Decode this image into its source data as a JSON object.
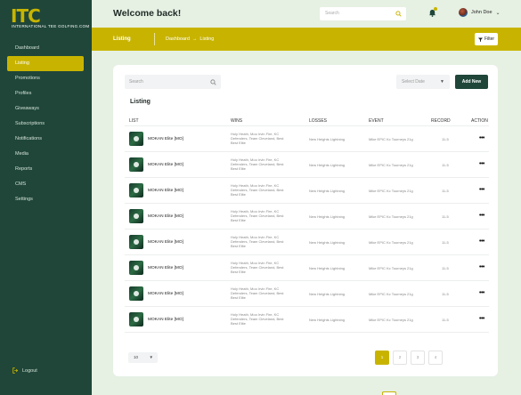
{
  "brand": {
    "logo_text": "ITC",
    "logo_subtext": "INTERNATIONAL TEE GOLFING.COM"
  },
  "sidebar": {
    "items": [
      {
        "label": "Dashboard",
        "active": false
      },
      {
        "label": "Listing",
        "active": true
      },
      {
        "label": "Promotions",
        "active": false
      },
      {
        "label": "Profiles",
        "active": false
      },
      {
        "label": "Giveaways",
        "active": false
      },
      {
        "label": "Subscriptions",
        "active": false
      },
      {
        "label": "Notifications",
        "active": false
      },
      {
        "label": "Media",
        "active": false
      },
      {
        "label": "Reports",
        "active": false
      },
      {
        "label": "CMS",
        "active": false
      },
      {
        "label": "Settings",
        "active": false
      }
    ],
    "logout_label": "Logout"
  },
  "header": {
    "welcome": "Welcome back!",
    "search_placeholder": "Search",
    "user_name": "John Doe"
  },
  "subheader": {
    "title": "Listing",
    "breadcrumb": [
      "Dashboard",
      "→",
      "Listing"
    ],
    "filter_label": "Filter"
  },
  "listing": {
    "search_placeholder": "Search",
    "date_select": "Select Date",
    "add_button": "Add New",
    "title": "Listing",
    "columns": [
      "LIST",
      "WINS",
      "LOSSES",
      "EVENT",
      "RECORD",
      "ACTION"
    ],
    "rows": [
      {
        "list": "MOKAN Elite [MO]",
        "wins": "Holy Heath, Moo Irvin Fire, KC Defenders, Team Cleveland, Best Best Elite",
        "losses": "New Heights Lightning",
        "event": "Mike EPIC Kc Tourneys 21g",
        "record": "11-5"
      },
      {
        "list": "MOKAN Elite [MO]",
        "wins": "Holy Heath, Moo Irvin Fire, KC Defenders, Team Cleveland, Best Best Elite",
        "losses": "New Heights Lightning",
        "event": "Mike EPIC Kc Tourneys 21g",
        "record": "11-5"
      },
      {
        "list": "MOKAN Elite [MO]",
        "wins": "Holy Heath, Moo Irvin Fire, KC Defenders, Team Cleveland, Best Best Elite",
        "losses": "New Heights Lightning",
        "event": "Mike EPIC Kc Tourneys 21g",
        "record": "11-5"
      },
      {
        "list": "MOKAN Elite [MO]",
        "wins": "Holy Heath, Moo Irvin Fire, KC Defenders, Team Cleveland, Best Best Elite",
        "losses": "New Heights Lightning",
        "event": "Mike EPIC Kc Tourneys 21g",
        "record": "11-5"
      },
      {
        "list": "MOKAN Elite [MO]",
        "wins": "Holy Heath, Moo Irvin Fire, KC Defenders, Team Cleveland, Best Best Elite",
        "losses": "New Heights Lightning",
        "event": "Mike EPIC Kc Tourneys 21g",
        "record": "11-5"
      },
      {
        "list": "MOKAN Elite [MO]",
        "wins": "Holy Heath, Moo Irvin Fire, KC Defenders, Team Cleveland, Best Best Elite",
        "losses": "New Heights Lightning",
        "event": "Mike EPIC Kc Tourneys 21g",
        "record": "11-5"
      },
      {
        "list": "MOKAN Elite [MO]",
        "wins": "Holy Heath, Moo Irvin Fire, KC Defenders, Team Cleveland, Best Best Elite",
        "losses": "New Heights Lightning",
        "event": "Mike EPIC Kc Tourneys 21g",
        "record": "11-5"
      },
      {
        "list": "MOKAN Elite [MO]",
        "wins": "Holy Heath, Moo Irvin Fire, KC Defenders, Team Cleveland, Best Best Elite",
        "losses": "New Heights Lightning",
        "event": "Mike EPIC Kc Tourneys 21g",
        "record": "11-5"
      }
    ],
    "action_label": "•••"
  },
  "pagination": {
    "per_page": "10",
    "pages": [
      "1",
      "2",
      "3",
      "4"
    ],
    "active_page": "1",
    "prev": "«",
    "next": "»"
  },
  "colors": {
    "sidebar": "#1f4639",
    "accent": "#c8b400",
    "background": "#e6f0e3"
  },
  "icons": [
    "search-icon",
    "bell-icon",
    "chevron-down-icon",
    "filter-icon",
    "logout-icon",
    "more-icon"
  ]
}
